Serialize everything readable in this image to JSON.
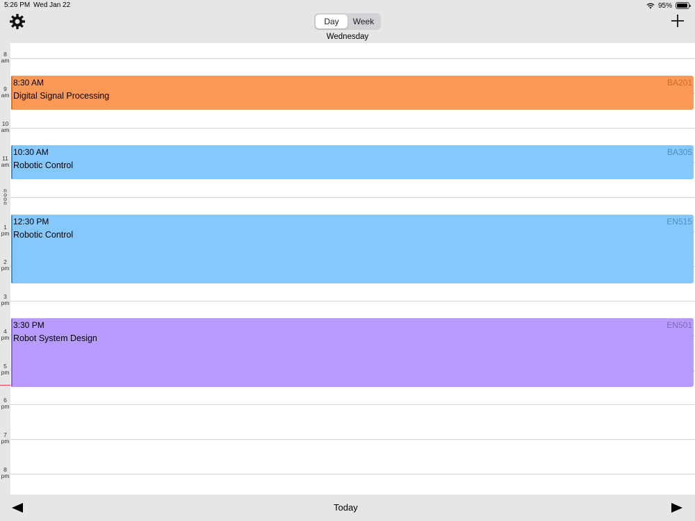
{
  "status": {
    "time": "5:26 PM",
    "date": "Wed Jan 22",
    "battery": "95%",
    "battery_level": 0.95
  },
  "nav": {
    "tabs": [
      "Day",
      "Week"
    ],
    "selected_tab": "Day",
    "day": "Wednesday"
  },
  "hours": [
    {
      "top": "8",
      "bottom": "am"
    },
    {
      "top": "9",
      "bottom": "am"
    },
    {
      "top": "10",
      "bottom": "am"
    },
    {
      "top": "11",
      "bottom": "am"
    },
    {
      "top": "n o o n",
      "bottom": ""
    },
    {
      "top": "1",
      "bottom": "pm"
    },
    {
      "top": "2",
      "bottom": "pm"
    },
    {
      "top": "3",
      "bottom": "pm"
    },
    {
      "top": "4",
      "bottom": "pm"
    },
    {
      "top": "5",
      "bottom": "pm"
    },
    {
      "top": "6",
      "bottom": "pm"
    },
    {
      "top": "7",
      "bottom": "pm"
    },
    {
      "top": "8",
      "bottom": "pm"
    }
  ],
  "events": [
    {
      "time": "8:30 AM",
      "title": "Digital Signal Processing",
      "room": "BA201",
      "start_hour": 8.5,
      "end_hour": 9.5,
      "color": "#fd9957",
      "bar_color": "#e46f23",
      "room_color": "#c96a2f"
    },
    {
      "time": "10:30 AM",
      "title": "Robotic Control",
      "room": "BA305",
      "start_hour": 10.5,
      "end_hour": 11.5,
      "color": "#84c8fd",
      "bar_color": "#4a90c8",
      "room_color": "#4d8fbd"
    },
    {
      "time": "12:30 PM",
      "title": "Robotic Control",
      "room": "EN515",
      "start_hour": 12.5,
      "end_hour": 14.5,
      "color": "#84c8fd",
      "bar_color": "#4a90c8",
      "room_color": "#4d8fbd"
    },
    {
      "time": "3:30 PM",
      "title": "Robot System Design",
      "room": "EN501",
      "start_hour": 15.5,
      "end_hour": 17.5,
      "color": "#b89cfd",
      "bar_color": "#8a6ad8",
      "room_color": "#7f66c4"
    }
  ],
  "current_time_hour": 17.43,
  "footer": {
    "today": "Today"
  }
}
